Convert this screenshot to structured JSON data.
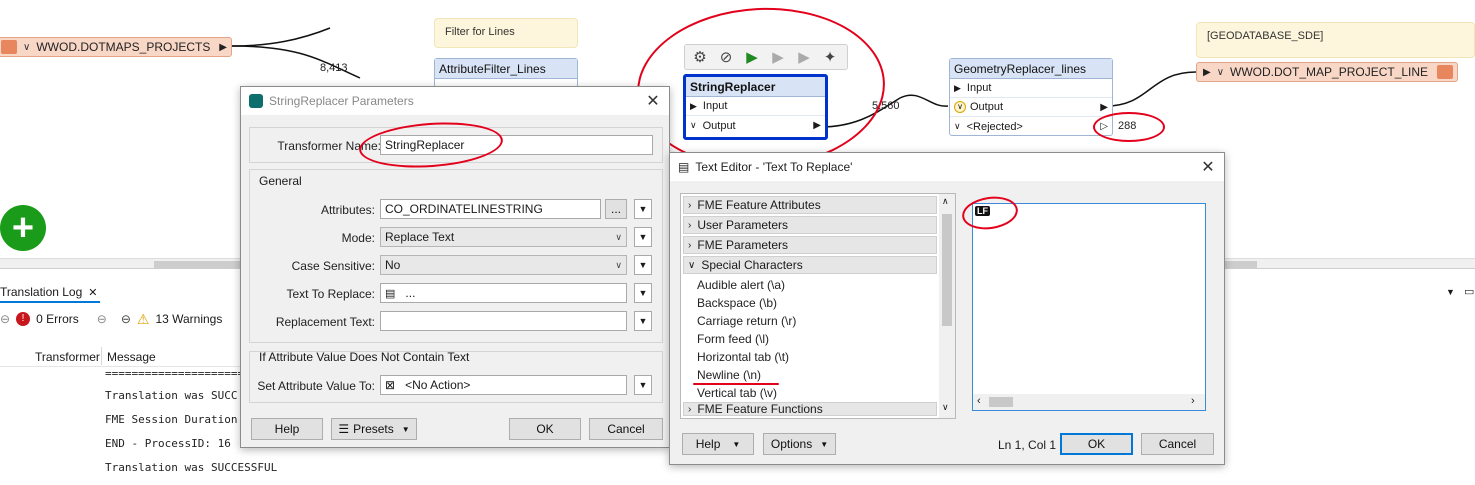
{
  "canvas": {
    "source_port": "WWOD.DOTMAPS_PROJECTS",
    "link_count_1": "8,413",
    "annotation_1": "Filter for Lines",
    "filter_title": "AttributeFilter_Lines",
    "toolbar_icons": [
      "gear-icon",
      "disable-icon",
      "run-icon",
      "run-to-icon",
      "run-from-icon",
      "sparkle-icon"
    ],
    "string_replacer": {
      "title": "StringReplacer",
      "input": "Input",
      "output": "Output"
    },
    "link_count_2": "5,560",
    "geom_replacer": {
      "title": "GeometryReplacer_lines",
      "input": "Input",
      "output": "Output",
      "rejected": "<Rejected>"
    },
    "rejected_count": "288",
    "annotation_2": "[GEODATABASE_SDE]",
    "dest_port": "WWOD.DOT_MAP_PROJECT_LINE",
    "add_button_glyph": "+"
  },
  "log": {
    "tab_label": "Translation Log",
    "tab_close": "✕",
    "errors_label": "0 Errors",
    "warnings_label": "13 Warnings",
    "col_transformer": "Transformer",
    "col_message": "Message",
    "lines": [
      "=========================",
      "Translation was SUCC",
      "FME Session Duration",
      "END - ProcessID: 16",
      "Translation was SUCCESSFUL"
    ]
  },
  "params_dialog": {
    "title": "StringReplacer Parameters",
    "transformer_name_label": "Transformer Name:",
    "transformer_name_value": "StringReplacer",
    "general_label": "General",
    "attributes_label": "Attributes:",
    "attributes_value": "CO_ORDINATELINESTRING",
    "ellipsis": "...",
    "mode_label": "Mode:",
    "mode_value": "Replace Text",
    "case_label": "Case Sensitive:",
    "case_value": "No",
    "text_to_replace_label": "Text To Replace:",
    "text_to_replace_value": "...",
    "replacement_label": "Replacement Text:",
    "replacement_value": "",
    "if_group_label": "If Attribute Value Does Not Contain Text",
    "set_attr_label": "Set Attribute Value To:",
    "set_attr_value": "<No Action>",
    "help_btn": "Help",
    "presets_btn": "Presets",
    "ok_btn": "OK",
    "cancel_btn": "Cancel"
  },
  "text_editor": {
    "title": "Text Editor - 'Text To Replace'",
    "groups": [
      "FME Feature Attributes",
      "User Parameters",
      "FME Parameters",
      "Special Characters"
    ],
    "special_chars": [
      "Audible alert (\\a)",
      "Backspace (\\b)",
      "Carriage return (\\r)",
      "Form feed (\\l)",
      "Horizontal tab (\\t)",
      "Newline (\\n)",
      "Vertical tab (\\v)"
    ],
    "last_group": "FME Feature Functions",
    "editor_token": "LF",
    "help_btn": "Help",
    "options_btn": "Options",
    "cursor_pos": "Ln 1, Col 1",
    "ok_btn": "OK",
    "cancel_btn": "Cancel"
  },
  "colors": {
    "selection": "#0033cc",
    "ink": "#e3001b",
    "port_fill": "#f8d7c6",
    "add_green": "#1a9b1a"
  }
}
